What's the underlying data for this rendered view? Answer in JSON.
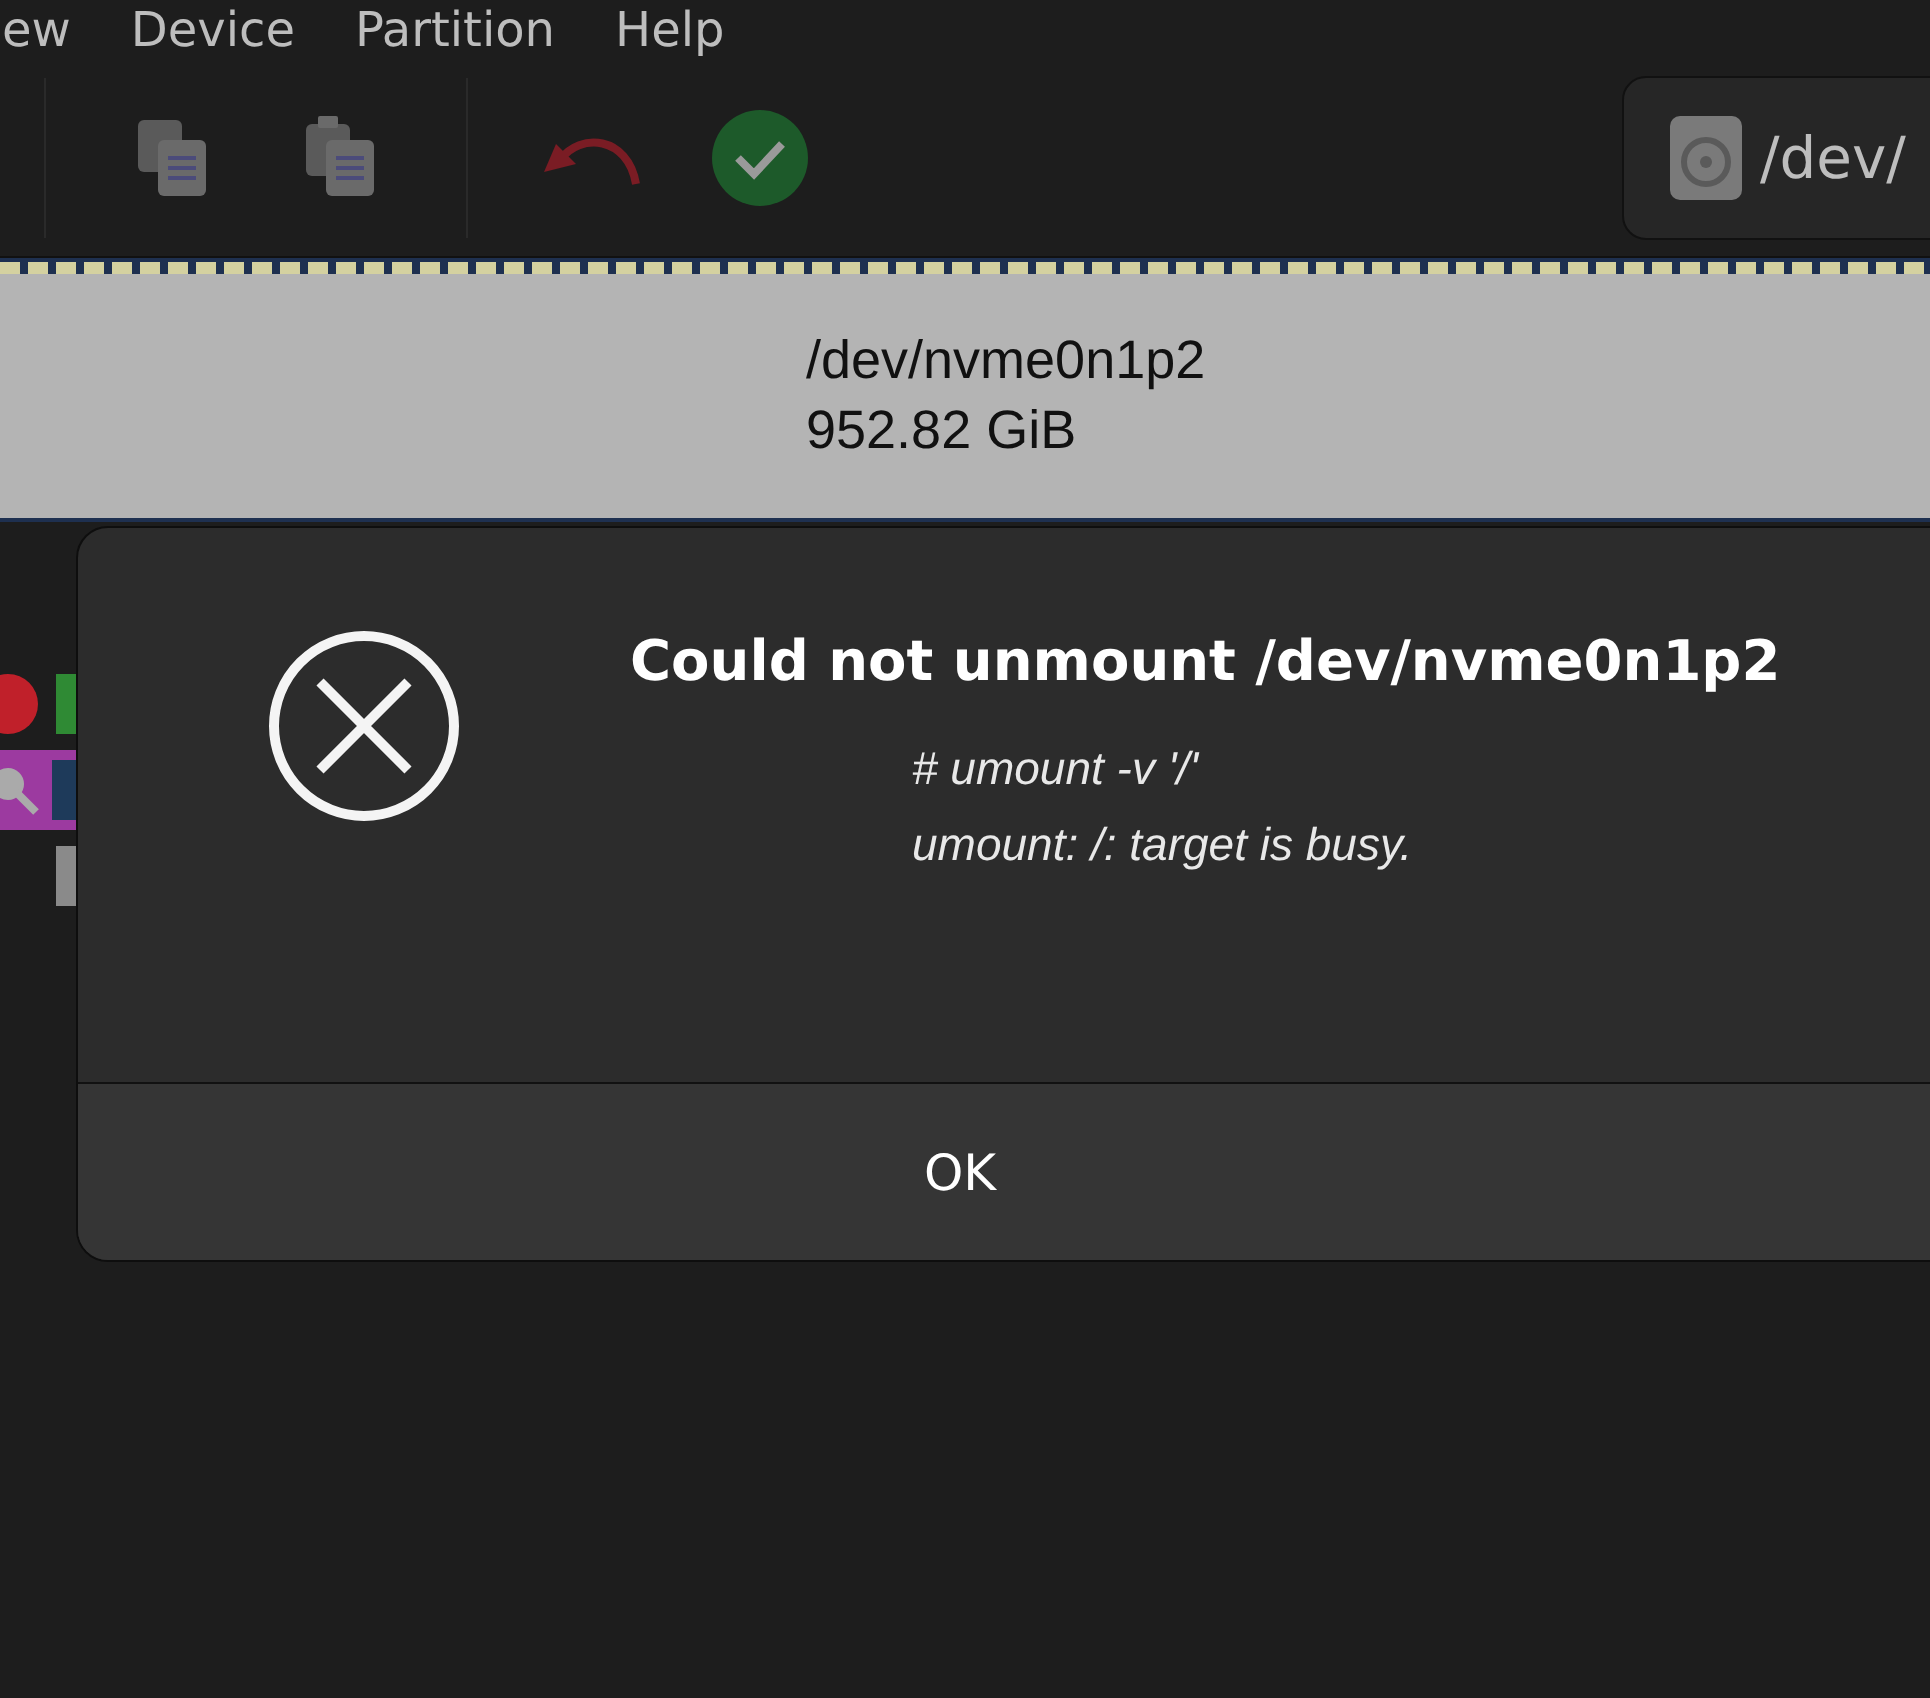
{
  "menu": [
    "ew",
    "Device",
    "Partition",
    "Help"
  ],
  "device_selector": {
    "label": "/dev/"
  },
  "partition": {
    "name": "/dev/nvme0n1p2",
    "size": "952.82 GiB"
  },
  "dialog": {
    "title": "Could not unmount /dev/nvme0n1p2",
    "details": [
      "# umount -v '/'",
      "umount: /: target is busy."
    ],
    "button": "OK"
  }
}
